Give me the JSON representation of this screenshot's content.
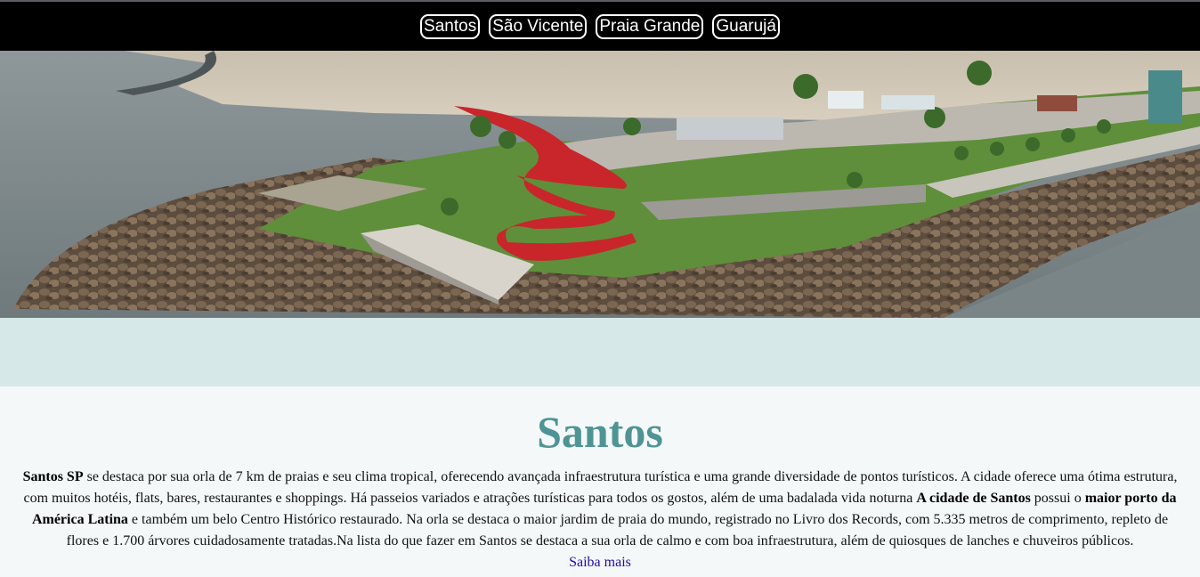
{
  "nav": {
    "items": [
      "Santos",
      "São Vicente",
      "Praia Grande",
      "Guarujá"
    ]
  },
  "hero": {
    "description": "Aerial photo of Santos waterfront with red sculpture"
  },
  "main": {
    "title": "Santos",
    "paragraph": {
      "p1_bold": "Santos SP",
      "p1": " se destaca por sua orla de 7 km de praias e seu clima tropical, oferecendo avançada infraestrutura turística e uma grande diversidade de pontos turísticos. A cidade oferece uma ótima estrutura, com muitos hotéis, flats, bares, restaurantes e shoppings. Há passeios variados e atrações turísticas para todos os gostos, além de uma badalada vida noturna ",
      "p2_bold": "A cidade de Santos",
      "p2": " possui o ",
      "p3_bold": "maior porto da América Latina",
      "p3": " e também um belo Centro Histórico restaurado. Na orla se destaca o maior jardim de praia do mundo, registrado no Livro dos Records, com 5.335 metros de comprimento, repleto de flores e 1.700 árvores cuidadosamente tratadas.Na lista do que fazer em Santos se destaca a sua orla de calmo e com boa infraestrutura, além de quiosques de lanches e chuveiros públicos."
    },
    "more_link": "Saiba mais"
  },
  "colors": {
    "nav_bg": "#000000",
    "band": "#d7e8e9",
    "title": "#4f9494",
    "page_bg": "#f4f8f9"
  }
}
